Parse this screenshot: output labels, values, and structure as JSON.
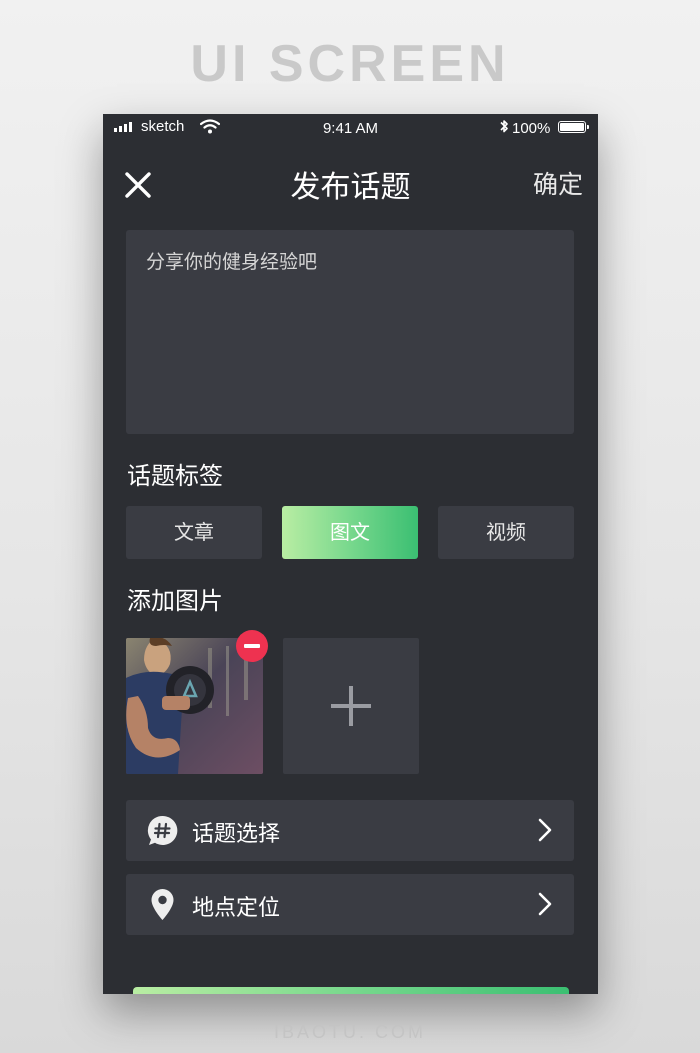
{
  "page": {
    "banner_title": "UI SCREEN",
    "footer_text": "IBAOTU. COM"
  },
  "status_bar": {
    "carrier": "sketch",
    "time": "9:41 AM",
    "battery": "100%"
  },
  "nav": {
    "title": "发布话题",
    "confirm_label": "确定",
    "close_icon": "close-icon"
  },
  "post": {
    "placeholder": "分享你的健身经验吧",
    "value": ""
  },
  "tags_section": {
    "title": "话题标签",
    "options": [
      {
        "label": "文章",
        "selected": false
      },
      {
        "label": "图文",
        "selected": true
      },
      {
        "label": "视频",
        "selected": false
      }
    ],
    "active_gradient": [
      "#b9eda3",
      "#3bbf72"
    ]
  },
  "photos_section": {
    "title": "添加图片",
    "photo_count": 1
  },
  "options": [
    {
      "label": "话题选择",
      "icon": "hashtag-bubble-icon"
    },
    {
      "label": "地点定位",
      "icon": "location-pin-icon"
    }
  ],
  "colors": {
    "background": "#2c2e33",
    "card": "#3a3c43",
    "remove_badge": "#ee3250",
    "accent": "#3bbf72"
  }
}
